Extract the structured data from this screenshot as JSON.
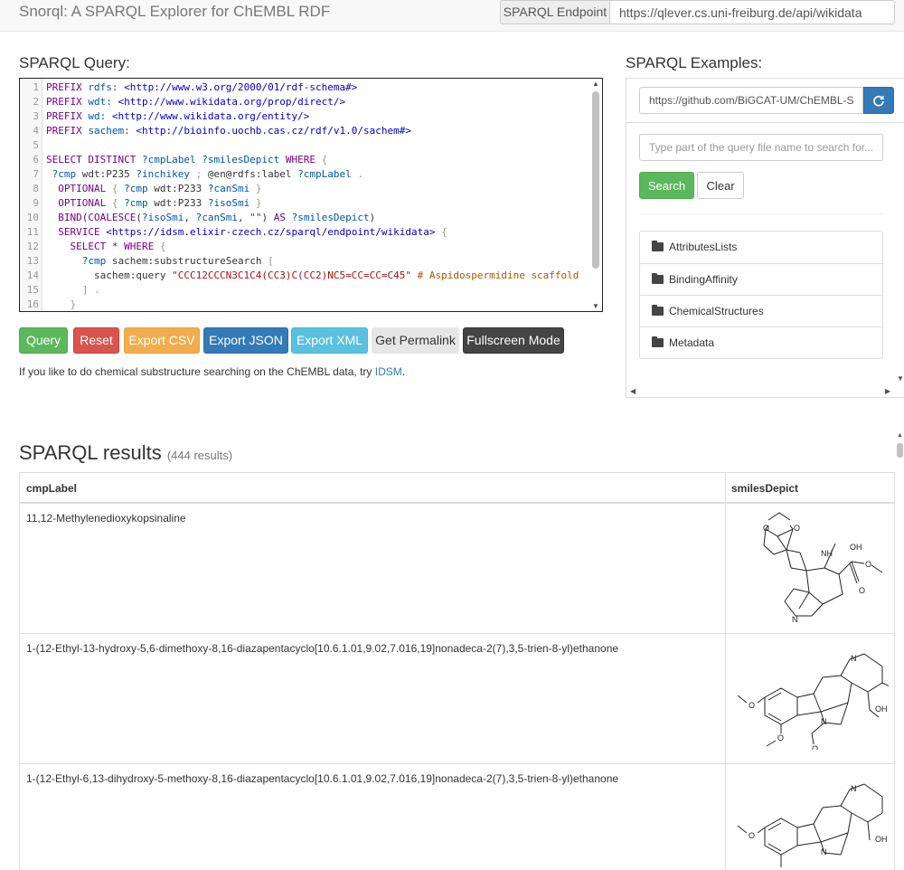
{
  "header": {
    "brand": "Snorql: A SPARQL Explorer for ChEMBL RDF",
    "endpoint_label": "SPARQL Endpoint",
    "endpoint_url": "https://qlever.cs.uni-freiburg.de/api/wikidata"
  },
  "query": {
    "title": "SPARQL Query:",
    "lines": [
      {
        "n": "1",
        "html": "<span class=\"k\">PREFIX</span> <span class=\"v\">rdfs:</span> <span class=\"a\">&lt;http://www.w3.org/2000/01/rdf-schema#&gt;</span>"
      },
      {
        "n": "2",
        "html": "<span class=\"k\">PREFIX</span> <span class=\"v\">wdt:</span> <span class=\"a\">&lt;http://www.wikidata.org/prop/direct/&gt;</span>"
      },
      {
        "n": "3",
        "html": "<span class=\"k\">PREFIX</span> <span class=\"v\">wd:</span> <span class=\"a\">&lt;http://www.wikidata.org/entity/&gt;</span>"
      },
      {
        "n": "4",
        "html": "<span class=\"k\">PREFIX</span> <span class=\"v\">sachem:</span> <span class=\"a\">&lt;http://bioinfo.uochb.cas.cz/rdf/v1.0/sachem#&gt;</span>"
      },
      {
        "n": "5",
        "html": ""
      },
      {
        "n": "6",
        "html": "<span class=\"k\">SELECT DISTINCT</span> <span class=\"v\">?cmpLabel ?smilesDepict</span> <span class=\"k\">WHERE</span> <span class=\"p\">{</span>"
      },
      {
        "n": "7",
        "html": " <span class=\"v\">?cmp</span> wdt:P235 <span class=\"v\">?inchikey</span> <span class=\"p\">;</span> @en@rdfs:label <span class=\"v\">?cmpLabel</span> <span class=\"p\">.</span>"
      },
      {
        "n": "8",
        "html": "  <span class=\"k\">OPTIONAL</span> <span class=\"p\">{</span> <span class=\"v\">?cmp</span> wdt:P233 <span class=\"v\">?canSmi</span> <span class=\"p\">}</span>"
      },
      {
        "n": "9",
        "html": "  <span class=\"k\">OPTIONAL</span> <span class=\"p\">{</span> <span class=\"v\">?cmp</span> wdt:P233 <span class=\"v\">?isoSmi</span> <span class=\"p\">}</span>"
      },
      {
        "n": "10",
        "html": "  <span class=\"k\">BIND</span>(<span class=\"k\">COALESCE</span>(<span class=\"v\">?isoSmi</span>, <span class=\"v\">?canSmi</span>, <span class=\"s\">\"\"</span>) <span class=\"k\">AS</span> <span class=\"v\">?smilesDepict</span>)"
      },
      {
        "n": "11",
        "html": "  <span class=\"k\">SERVICE</span> <span class=\"a\">&lt;https://idsm.elixir-czech.cz/sparql/endpoint/wikidata&gt;</span> <span class=\"p\">{</span>"
      },
      {
        "n": "12",
        "html": "    <span class=\"k\">SELECT</span> * <span class=\"k\">WHERE</span> <span class=\"p\">{</span>"
      },
      {
        "n": "13",
        "html": "      <span class=\"v\">?cmp</span> sachem:substructureSearch <span class=\"p\">[</span>"
      },
      {
        "n": "14",
        "html": "        sachem:query <span class=\"s\">\"CCC12CCCN3C1C4(CC3)C(CC2)NC5=CC=CC=C45\"</span> <span class=\"c\"># Aspidospermidine scaffold</span>"
      },
      {
        "n": "15",
        "html": "      <span class=\"p\">] .</span>"
      },
      {
        "n": "16",
        "html": "    <span class=\"p\">}</span>"
      }
    ]
  },
  "buttons": {
    "query": "Query",
    "reset": "Reset",
    "export_csv": "Export CSV",
    "export_json": "Export JSON",
    "export_xml": "Export XML",
    "permalink": "Get Permalink",
    "fullscreen": "Fullscreen Mode"
  },
  "note": {
    "text": "If you like to do chemical substructure searching on the ChEMBL data, try ",
    "link": "IDSM",
    "end": "."
  },
  "examples": {
    "title": "SPARQL Examples:",
    "repo_url": "https://github.com/BiGCAT-UM/ChEMBL-S",
    "search_placeholder": "Type part of the query file name to search for...",
    "search_label": "Search",
    "clear_label": "Clear",
    "folders": [
      "AttributesLists",
      "BindingAffinity",
      "ChemicalStructures",
      "Metadata"
    ]
  },
  "results": {
    "title": "SPARQL results",
    "count": "(444 results)",
    "columns": [
      "cmpLabel",
      "smilesDepict"
    ],
    "rows": [
      "11,12-Methylenedioxykopsinaline",
      "1-(12-Ethyl-13-hydroxy-5,6-dimethoxy-8,16-diazapentacyclo[10.6.1.01,9.02,7.016,19]nonadeca-2(7),3,5-trien-8-yl)ethanone",
      "1-(12-Ethyl-6,13-dihydroxy-5-methoxy-8,16-diazapentacyclo[10.6.1.01,9.02,7.016,19]nonadeca-2(7),3,5-trien-8-yl)ethanone"
    ],
    "mol_labels": {
      "row1": [
        "O",
        "O",
        "NH",
        "OH",
        "O",
        "O",
        "N"
      ],
      "row2": [
        "N",
        "OH",
        "O",
        "N",
        "O",
        "O"
      ],
      "row3": [
        "N",
        "OH",
        "O",
        "N"
      ]
    }
  },
  "colors": {
    "success": "#5cb85c",
    "danger": "#d9534f",
    "warning": "#f0ad4e",
    "primary": "#337ab7",
    "info": "#5bc0de",
    "dark": "#444444"
  }
}
